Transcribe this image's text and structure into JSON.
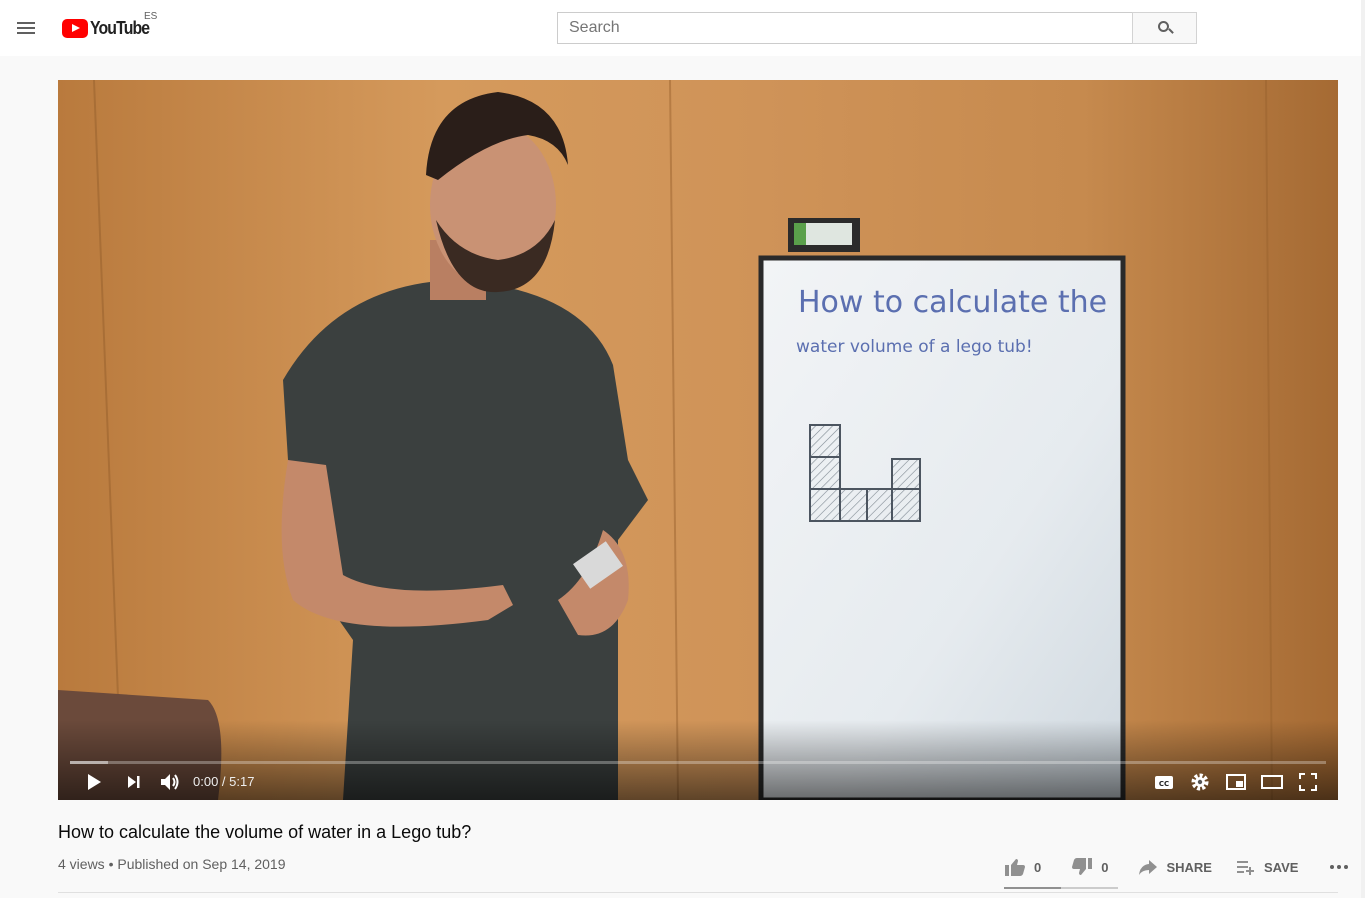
{
  "header": {
    "logo_text": "YouTube",
    "region": "ES",
    "search_placeholder": "Search",
    "menu_icon": "hamburger-menu-icon",
    "search_icon": "search-icon"
  },
  "player": {
    "time_display": "0:00 / 5:17",
    "progress": 0,
    "buffered": 0.03,
    "controls": [
      "play-icon",
      "next-icon",
      "volume-icon",
      "subtitles-icon",
      "settings-icon",
      "miniplayer-icon",
      "theater-icon",
      "fullscreen-icon"
    ]
  },
  "video": {
    "title": "How to calculate the volume of water in a Lego tub?",
    "meta": "4 views • Published on Sep 14, 2019",
    "likes": "0",
    "dislikes": "0",
    "share_label": "SHARE",
    "save_label": "SAVE",
    "like_ratio": 0.5
  },
  "whiteboard": {
    "line1": "How to calculate the",
    "line2": "water volume of a lego tub!"
  },
  "colors": {
    "accent": "#ff0000",
    "text_primary": "#0a0a0a",
    "text_secondary": "#606060"
  }
}
